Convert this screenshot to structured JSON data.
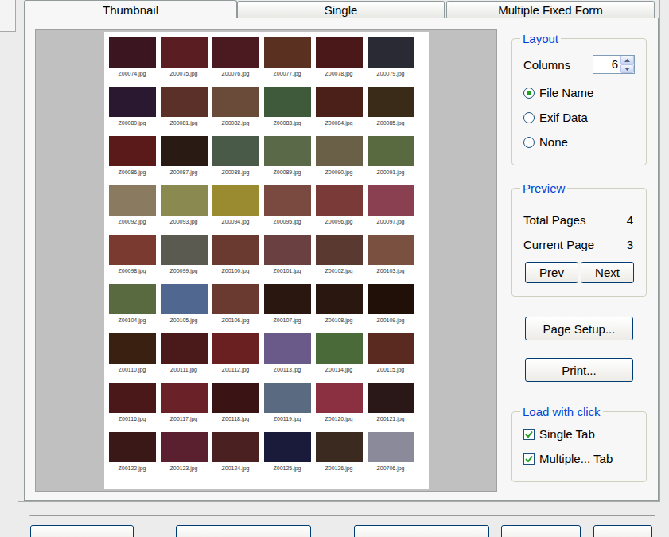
{
  "tabs": [
    {
      "label": "Thumbnail",
      "selected": true
    },
    {
      "label": "Single",
      "selected": false
    },
    {
      "label": "Multiple Fixed Form",
      "selected": false
    }
  ],
  "preview": {
    "thumbnails": [
      {
        "name": "Z00074.jpg",
        "color": "#3b1620"
      },
      {
        "name": "Z00075.jpg",
        "color": "#5a1e22"
      },
      {
        "name": "Z00076.jpg",
        "color": "#4a1a20"
      },
      {
        "name": "Z00077.jpg",
        "color": "#5a3020"
      },
      {
        "name": "Z00078.jpg",
        "color": "#4a1818"
      },
      {
        "name": "Z00079.jpg",
        "color": "#2a2a34"
      },
      {
        "name": "Z00080.jpg",
        "color": "#2a1830"
      },
      {
        "name": "Z00081.jpg",
        "color": "#5a3028"
      },
      {
        "name": "Z00082.jpg",
        "color": "#6a4a38"
      },
      {
        "name": "Z00083.jpg",
        "color": "#3e5a3a"
      },
      {
        "name": "Z00084.jpg",
        "color": "#4a2018"
      },
      {
        "name": "Z00085.jpg",
        "color": "#3a2a18"
      },
      {
        "name": "Z00086.jpg",
        "color": "#5a1a1a"
      },
      {
        "name": "Z00087.jpg",
        "color": "#2a1a14"
      },
      {
        "name": "Z00088.jpg",
        "color": "#4a5a48"
      },
      {
        "name": "Z00089.jpg",
        "color": "#5a6a48"
      },
      {
        "name": "Z00090.jpg",
        "color": "#6a6048"
      },
      {
        "name": "Z00091.jpg",
        "color": "#5a6a40"
      },
      {
        "name": "Z00092.jpg",
        "color": "#8a7a60"
      },
      {
        "name": "Z00093.jpg",
        "color": "#8a8a50"
      },
      {
        "name": "Z00094.jpg",
        "color": "#9a8a30"
      },
      {
        "name": "Z00095.jpg",
        "color": "#7a4a40"
      },
      {
        "name": "Z00096.jpg",
        "color": "#7a3a38"
      },
      {
        "name": "Z00097.jpg",
        "color": "#8a4050"
      },
      {
        "name": "Z00098.jpg",
        "color": "#7a3a30"
      },
      {
        "name": "Z00099.jpg",
        "color": "#5a5a50"
      },
      {
        "name": "Z00100.jpg",
        "color": "#6a3a30"
      },
      {
        "name": "Z00101.jpg",
        "color": "#6a4040"
      },
      {
        "name": "Z00102.jpg",
        "color": "#5a3a30"
      },
      {
        "name": "Z00103.jpg",
        "color": "#7a5040"
      },
      {
        "name": "Z00104.jpg",
        "color": "#5a6a40"
      },
      {
        "name": "Z00105.jpg",
        "color": "#506890"
      },
      {
        "name": "Z00106.jpg",
        "color": "#6a3a30"
      },
      {
        "name": "Z00107.jpg",
        "color": "#2a1810"
      },
      {
        "name": "Z00108.jpg",
        "color": "#2a1810"
      },
      {
        "name": "Z00109.jpg",
        "color": "#201008"
      },
      {
        "name": "Z00110.jpg",
        "color": "#3a2010"
      },
      {
        "name": "Z00111.jpg",
        "color": "#4a1a1a"
      },
      {
        "name": "Z00112.jpg",
        "color": "#6a2020"
      },
      {
        "name": "Z00113.jpg",
        "color": "#6a5a8a"
      },
      {
        "name": "Z00114.jpg",
        "color": "#4a6a3a"
      },
      {
        "name": "Z00115.jpg",
        "color": "#5a2a20"
      },
      {
        "name": "Z00116.jpg",
        "color": "#4a1818"
      },
      {
        "name": "Z00117.jpg",
        "color": "#6a2228"
      },
      {
        "name": "Z00118.jpg",
        "color": "#3a1414"
      },
      {
        "name": "Z00119.jpg",
        "color": "#5a6a80"
      },
      {
        "name": "Z00120.jpg",
        "color": "#8a3040"
      },
      {
        "name": "Z00121.jpg",
        "color": "#2a1818"
      },
      {
        "name": "Z00122.jpg",
        "color": "#3a1818"
      },
      {
        "name": "Z00123.jpg",
        "color": "#5a2030"
      },
      {
        "name": "Z00124.jpg",
        "color": "#4a2020"
      },
      {
        "name": "Z00125.jpg",
        "color": "#1a1a3a"
      },
      {
        "name": "Z00126.jpg",
        "color": "#3a2a20"
      },
      {
        "name": "Z00706.jpg",
        "color": "#8a8a9a"
      }
    ]
  },
  "layout": {
    "title": "Layout",
    "columns_label": "Columns",
    "columns_value": "6",
    "options": [
      {
        "label": "File Name",
        "selected": true
      },
      {
        "label": "Exif Data",
        "selected": false
      },
      {
        "label": "None",
        "selected": false
      }
    ]
  },
  "preview_info": {
    "title": "Preview",
    "rows": [
      {
        "label": "Total Pages",
        "value": "4"
      },
      {
        "label": "Current Page",
        "value": "3"
      }
    ],
    "buttons": [
      "Prev",
      "Next"
    ]
  },
  "actions": [
    "Page Setup...",
    "Print..."
  ],
  "load_with_click": {
    "title": "Load with click",
    "options": [
      {
        "label": "Single Tab",
        "checked": true
      },
      {
        "label": "Multiple... Tab",
        "checked": true
      }
    ]
  },
  "progress": {
    "level": 0
  }
}
